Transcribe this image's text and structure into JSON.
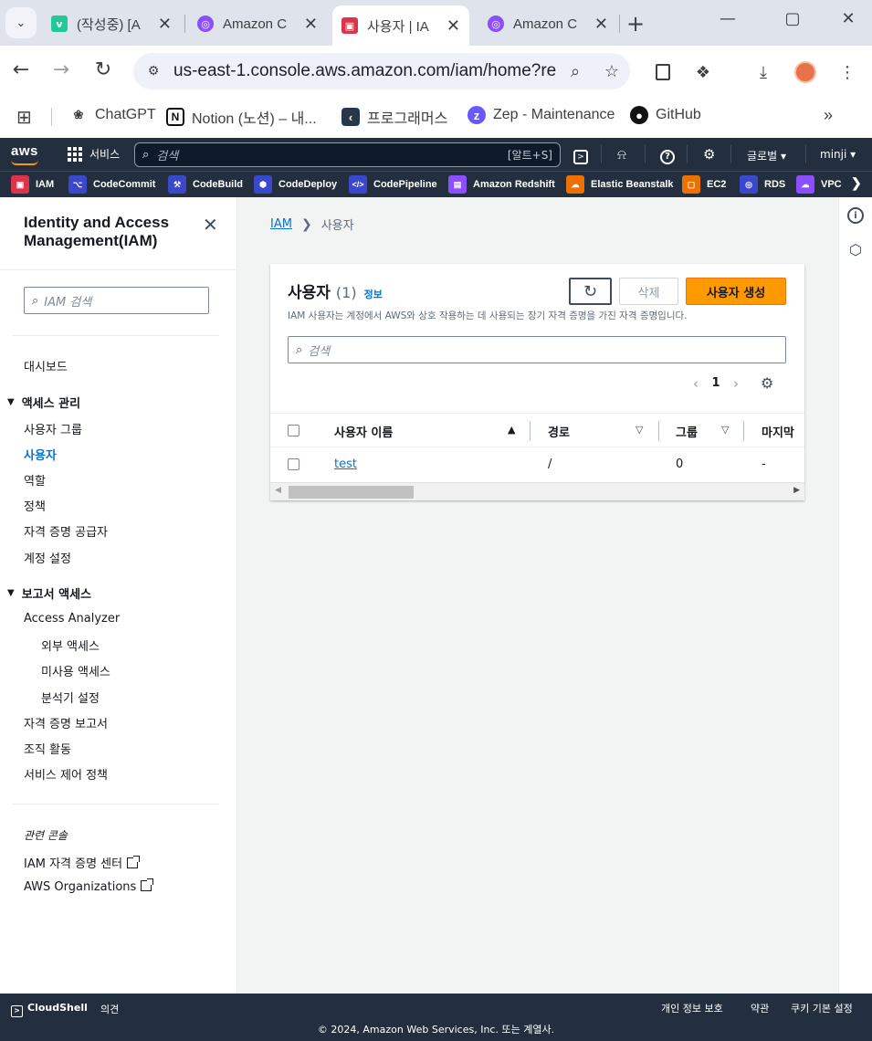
{
  "browser": {
    "tabs": [
      {
        "title": "(작성중) [A",
        "active": false
      },
      {
        "title": "Amazon C",
        "active": false
      },
      {
        "title": "사용자 | IA",
        "active": true
      },
      {
        "title": "Amazon C",
        "active": false
      }
    ],
    "url": "us-east-1.console.aws.amazon.com/iam/home?re...",
    "bookmarks": [
      {
        "label": "ChatGPT",
        "icon": "chatgpt-icon"
      },
      {
        "label": "Notion (노션) – 내...",
        "icon": "notion-icon"
      },
      {
        "label": "프로그래머스",
        "icon": "programmers-icon"
      },
      {
        "label": "Zep - Maintenance",
        "icon": "zep-icon"
      },
      {
        "label": "GitHub",
        "icon": "github-icon"
      }
    ]
  },
  "aws_nav": {
    "logo": "aws",
    "services_label": "서비스",
    "search_placeholder": "검색",
    "search_shortcut": "[알트+S]",
    "region_label": "글로벌",
    "account_label": "minji",
    "favorites": [
      {
        "label": "IAM",
        "color": "#dd344c"
      },
      {
        "label": "CodeCommit",
        "color": "#3b48cc"
      },
      {
        "label": "CodeBuild",
        "color": "#3b48cc"
      },
      {
        "label": "CodeDeploy",
        "color": "#3b48cc"
      },
      {
        "label": "CodePipeline",
        "color": "#3b48cc"
      },
      {
        "label": "Amazon Redshift",
        "color": "#8c4fff"
      },
      {
        "label": "Elastic Beanstalk",
        "color": "#ed7100"
      },
      {
        "label": "EC2",
        "color": "#ed7100"
      },
      {
        "label": "RDS",
        "color": "#3b48cc"
      },
      {
        "label": "VPC",
        "color": "#8c4fff"
      }
    ]
  },
  "sidebar": {
    "title": "Identity and Access Management(IAM)",
    "search_placeholder": "IAM 검색",
    "dashboard": "대시보드",
    "access_mgmt": {
      "label": "액세스 관리",
      "items": [
        "사용자 그룹",
        "사용자",
        "역할",
        "정책",
        "자격 증명 공급자",
        "계정 설정"
      ],
      "active": "사용자"
    },
    "access_reports": {
      "label": "보고서 액세스",
      "analyzer": "Access Analyzer",
      "analyzer_sub": [
        "외부 액세스",
        "미사용 액세스",
        "분석기 설정"
      ],
      "items": [
        "자격 증명 보고서",
        "조직 활동",
        "서비스 제어 정책"
      ]
    },
    "related_label": "관련 콘솔",
    "related": [
      "IAM 자격 증명 센터",
      "AWS Organizations"
    ]
  },
  "main": {
    "breadcrumb": {
      "root": "IAM",
      "current": "사용자"
    },
    "panel": {
      "title": "사용자",
      "count": "(1)",
      "info": "정보",
      "description": "IAM 사용자는 계정에서 AWS와 상호 작용하는 데 사용되는 장기 자격 증명을 가진 자격 증명입니다.",
      "delete_label": "삭제",
      "create_label": "사용자 생성",
      "search_placeholder": "검색",
      "page": "1"
    },
    "table": {
      "headers": [
        "사용자 이름",
        "경로",
        "그룹",
        "마지막 "
      ],
      "rows": [
        {
          "name": "test",
          "path": "/",
          "groups": "0",
          "last": "-"
        }
      ]
    }
  },
  "footer": {
    "cloudshell": "CloudShell",
    "feedback": "의견",
    "privacy": "개인 정보 보호",
    "terms": "약관",
    "cookies": "쿠키 기본 설정",
    "copyright": "© 2024, Amazon Web Services, Inc. 또는 계열사."
  }
}
